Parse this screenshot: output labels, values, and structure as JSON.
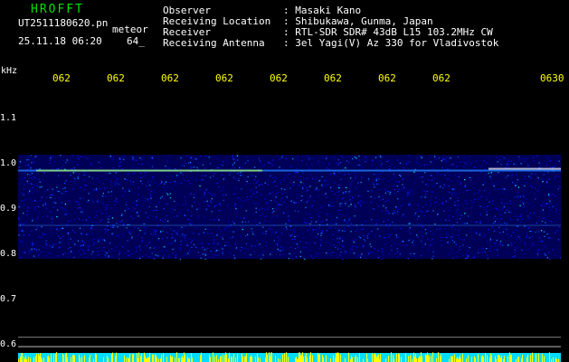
{
  "header": {
    "title": "HROFFT",
    "filename": "UT2511180620.pn",
    "mode": "meteor",
    "datetime": "25.11.18 06:20",
    "gain": "64_"
  },
  "info": [
    {
      "label": "Observer",
      "value": ": Masaki Kano"
    },
    {
      "label": "Receiving Location",
      "value": ": Shibukawa, Gunma, Japan"
    },
    {
      "label": "Receiver",
      "value": ": RTL-SDR SDR# 43dB L15 103.2MHz CW"
    },
    {
      "label": "Receiving Antenna",
      "value": ": 3el Yagi(V) Az 330 for Vladivostok"
    }
  ],
  "chart_data": {
    "type": "heatmap",
    "ylabel": "kHz",
    "x_ticks": [
      "062",
      "062",
      "062",
      "062",
      "062",
      "062",
      "062",
      "062",
      "0630"
    ],
    "y_ticks": [
      "1.1",
      "1.0",
      "0.9",
      "0.8",
      "0.7",
      "0.6"
    ],
    "ylim": [
      0.58,
      1.2
    ],
    "noise_band_khz": [
      0.8,
      1.0
    ],
    "carrier_khz": 0.985,
    "colors": {
      "background": "#000000",
      "noise_low": "#0000aa",
      "noise_high": "#00ffff",
      "signal": "#ffff00"
    }
  }
}
